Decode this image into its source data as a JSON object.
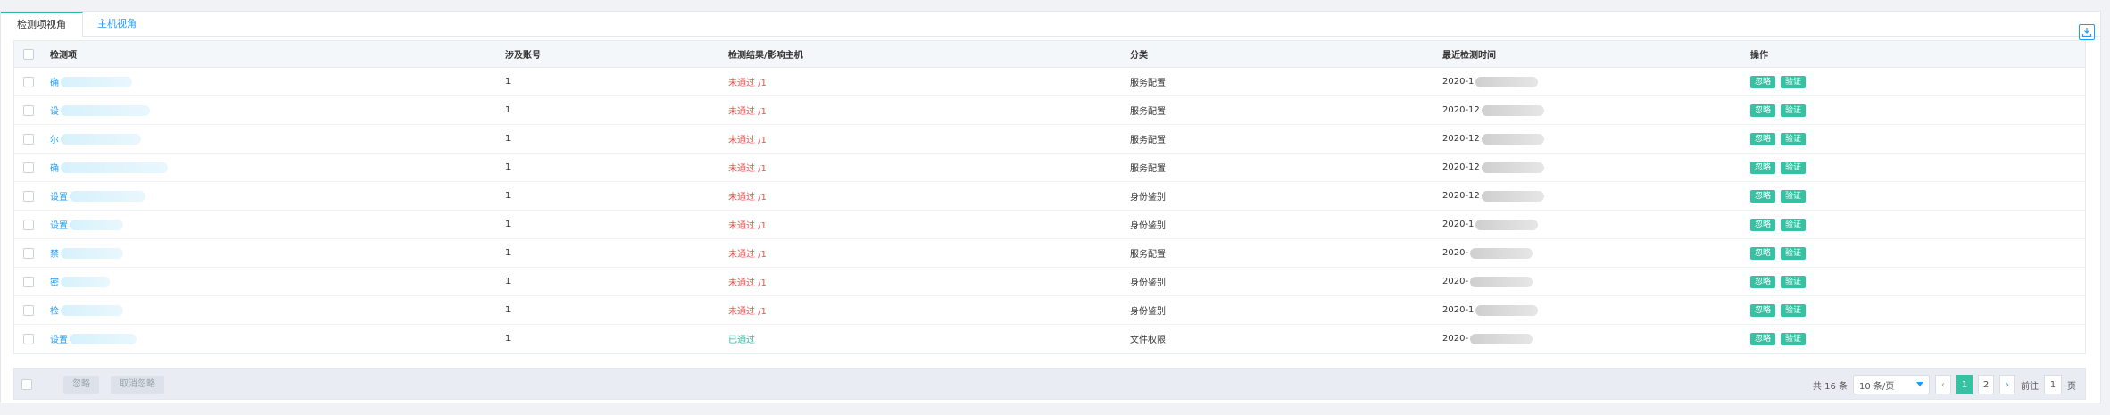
{
  "tabs": [
    {
      "label": "检测项视角",
      "active": true
    },
    {
      "label": "主机视角",
      "active": false
    }
  ],
  "table": {
    "headers": {
      "item": "检测项",
      "account": "涉及账号",
      "result": "检测结果/影响主机",
      "category": "分类",
      "time": "最近检测时间",
      "op": "操作"
    },
    "rows": [
      {
        "item": "确",
        "account": "1",
        "result": "未通过 /1",
        "status": "fail",
        "category": "服务配置",
        "time": "2020-1"
      },
      {
        "item": "设",
        "account": "1",
        "result": "未通过 /1",
        "status": "fail",
        "category": "服务配置",
        "time": "2020-12"
      },
      {
        "item": "尔",
        "account": "1",
        "result": "未通过 /1",
        "status": "fail",
        "category": "服务配置",
        "time": "2020-12"
      },
      {
        "item": "确",
        "account": "1",
        "result": "未通过 /1",
        "status": "fail",
        "category": "服务配置",
        "time": "2020-12"
      },
      {
        "item": "设置",
        "account": "1",
        "result": "未通过 /1",
        "status": "fail",
        "category": "身份鉴别",
        "time": "2020-12"
      },
      {
        "item": "设置",
        "account": "1",
        "result": "未通过 /1",
        "status": "fail",
        "category": "身份鉴别",
        "time": "2020-1"
      },
      {
        "item": "禁",
        "account": "1",
        "result": "未通过 /1",
        "status": "fail",
        "category": "服务配置",
        "time": "2020-"
      },
      {
        "item": "密",
        "account": "1",
        "result": "未通过 /1",
        "status": "fail",
        "category": "身份鉴别",
        "time": "2020-"
      },
      {
        "item": "检",
        "account": "1",
        "result": "未通过 /1",
        "status": "fail",
        "category": "身份鉴别",
        "time": "2020-1"
      },
      {
        "item": "设置",
        "account": "1",
        "result": "已通过",
        "status": "pass",
        "category": "文件权限",
        "time": "2020-"
      }
    ],
    "row_actions": {
      "ignore": "忽略",
      "verify": "验证"
    }
  },
  "footer": {
    "ignore_label": "忽略",
    "unignore_label": "取消忽略",
    "total_text": "共 16 条",
    "page_size": "10 条/页",
    "pages": [
      "1",
      "2"
    ],
    "current_page": 1,
    "goto_label": "前往",
    "goto_value": "1",
    "page_suffix": "页"
  },
  "colors": {
    "accent": "#35c2a2",
    "link": "#1e9bff",
    "fail": "#f05050"
  }
}
